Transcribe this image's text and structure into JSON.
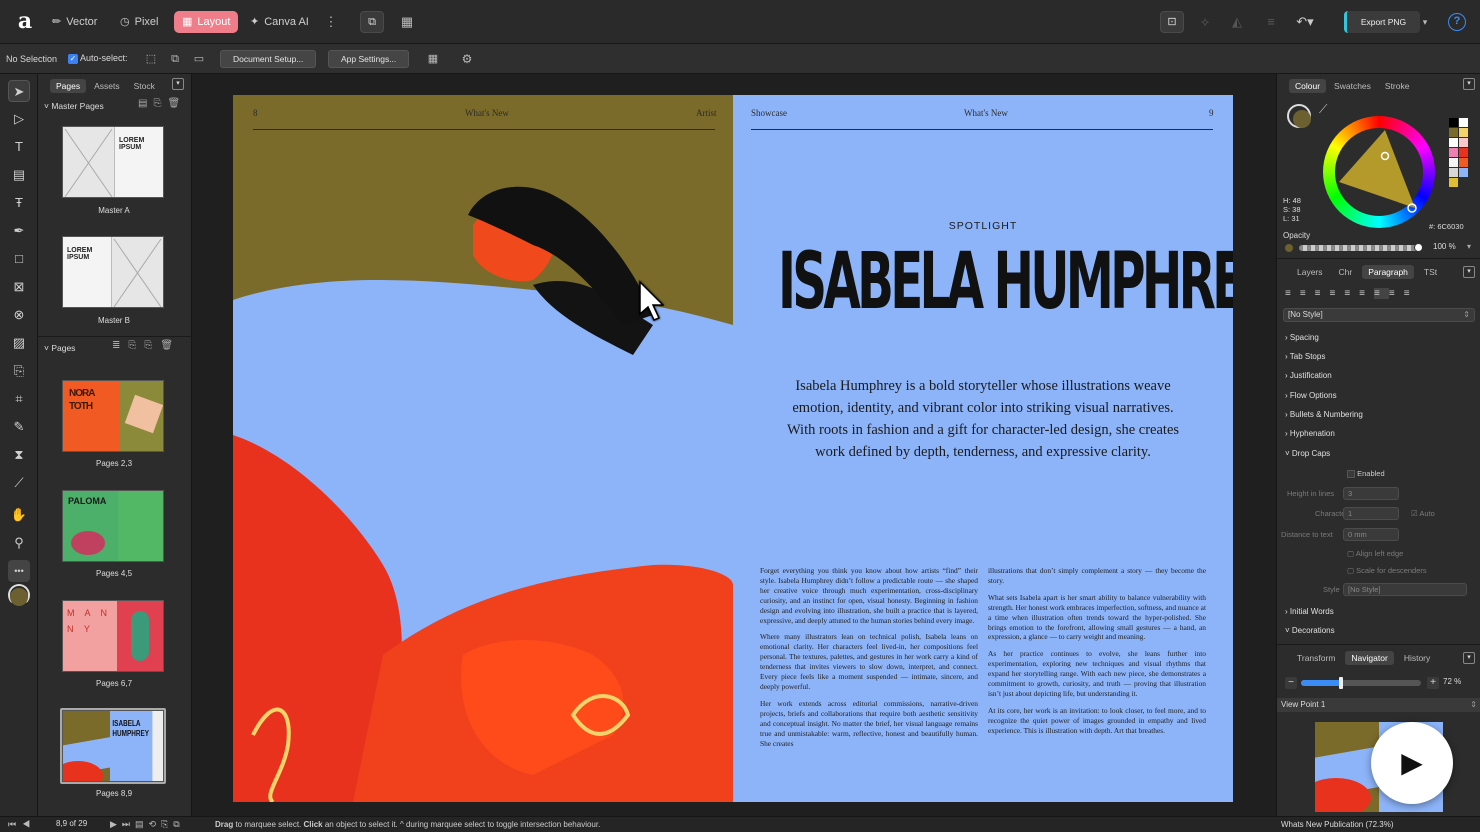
{
  "app": {
    "logo_glyph": "a"
  },
  "personas": [
    {
      "label": "Vector",
      "icon": "✏"
    },
    {
      "label": "Pixel",
      "icon": "◷"
    },
    {
      "label": "Layout",
      "icon": "▦"
    },
    {
      "label": "Canva AI",
      "icon": "✦"
    }
  ],
  "toolbar": {
    "export_label": "Export PNG",
    "help": "?"
  },
  "context": {
    "selection": "No Selection",
    "auto_select": "Auto-select:",
    "document_setup": "Document Setup...",
    "app_settings": "App Settings..."
  },
  "left_panel": {
    "tabs": [
      "Pages",
      "Assets",
      "Stock"
    ],
    "master_pages_title": "Master Pages",
    "pages_title": "Pages",
    "masters": [
      {
        "label": "Master A",
        "text": "LOREM IPSUM"
      },
      {
        "label": "Master B",
        "text": "LOREM IPSUM"
      }
    ],
    "pages": [
      {
        "label": "Pages 2,3",
        "text": "NORA TOTH"
      },
      {
        "label": "Pages 4,5",
        "text": "PALOMA"
      },
      {
        "label": "Pages 6,7",
        "text": "M A N N Y"
      },
      {
        "label": "Pages 8,9",
        "text": "ISABELA HUMPHREY"
      }
    ]
  },
  "spread": {
    "left_header": {
      "page": "8",
      "section": "What's New",
      "label": "Artist"
    },
    "right_header": {
      "label": "Showcase",
      "section": "What's New",
      "page": "9"
    },
    "kicker": "SPOTLIGHT",
    "title": "ISABELA HUMPHREY",
    "intro": "Isabela Humphrey is a bold storyteller whose illustrations weave emotion, identity, and vibrant color into striking visual narratives. With roots in fashion and a gift for character-led design, she creates work defined by depth, tenderness, and expressive clarity.",
    "col1": [
      "Forget everything you think you know about how artists “find” their style. Isabela Humphrey didn’t follow a predictable route — she shaped her creative voice through much experimentation, cross-disciplinary curiosity, and an instinct for open, visual honesty. Beginning in fashion design and evolving into illustration, she built a practice that is layered, expressive, and deeply attuned to the human stories behind every image.",
      "Where many illustrators lean on technical polish, Isabela leans on emotional clarity. Her characters feel lived-in, her compositions feel personal. The textures, palettes, and gestures in her work carry a kind of tenderness that invites viewers to slow down, interpret, and connect. Every piece feels like a moment suspended — intimate, sincere, and deeply powerful.",
      "Her work extends across editorial commissions, narrative-driven projects, briefs and collaborations that require both aesthetic sensitivity and conceptual insight. No matter the brief, her visual language remains true and unmistakable: warm, reflective, honest and beautifully human. She creates"
    ],
    "col2": [
      "illustrations that don’t simply complement a story — they become the story.",
      "What sets Isabela apart is her smart ability to balance vulnerability with strength. Her honest work embraces imperfection, softness, and nuance at a time when illustration often trends toward the hyper-polished. She brings emotion to the forefront, allowing small gestures — a hand, an expression, a glance — to carry weight and meaning.",
      "As her practice continues to evolve, she leans further into experimentation, exploring new techniques and visual rhythms that expand her storytelling range. With each new piece, she demonstrates a commitment to growth, curiosity, and truth — proving that illustration isn’t just about depicting life, but understanding it.",
      "At its core, her work is an invitation: to look closer, to feel more, and to recognize the quiet power of images grounded in empathy and lived experience. This is illustration with depth. Art that breathes."
    ]
  },
  "right_panel": {
    "colour_tabs": [
      "Colour",
      "Swatches",
      "Stroke"
    ],
    "hsl": {
      "h": "H: 48",
      "s": "S: 38",
      "l": "L: 31"
    },
    "hex": "#: 6C6030",
    "opacity_label": "Opacity",
    "opacity_value": "100 %",
    "para_tabs": [
      "Layers",
      "Chr",
      "Paragraph",
      "TSt"
    ],
    "style_select": "[No Style]",
    "sections": [
      "Spacing",
      "Tab Stops",
      "Justification",
      "Flow Options",
      "Bullets & Numbering",
      "Hyphenation",
      "Drop Caps"
    ],
    "dropcaps": {
      "enabled": "Enabled",
      "height_label": "Height in lines",
      "height_value": "3",
      "chars_label": "Characters",
      "chars_value": "1",
      "auto": "Auto",
      "distance_label": "Distance to text",
      "distance_value": "0 mm",
      "align_left": "Align left edge",
      "scale_desc": "Scale for descenders",
      "style_label": "Style",
      "style_value": "[No Style]"
    },
    "sections2": [
      "Initial Words",
      "Decorations"
    ],
    "nav_tabs": [
      "Transform",
      "Navigator",
      "History"
    ],
    "zoom": {
      "value": "72 %",
      "fraction": 0.33
    },
    "view_point": "View Point 1",
    "doc_status": "Whats New Publication (72.3%)"
  },
  "status": {
    "page_counter": "8,9 of 29",
    "hint_drag": "Drag",
    "hint_1": " to marquee select. ",
    "hint_click": "Click",
    "hint_2": " an object to select it. ^ during marquee select to toggle intersection behaviour."
  },
  "colors": {
    "accent_layout": "#f07e8a",
    "current_fill": "#6C6030",
    "page_blue": "#8db4f9",
    "page_olive": "#7a6b2b",
    "export_accent": "#35c4d8"
  }
}
